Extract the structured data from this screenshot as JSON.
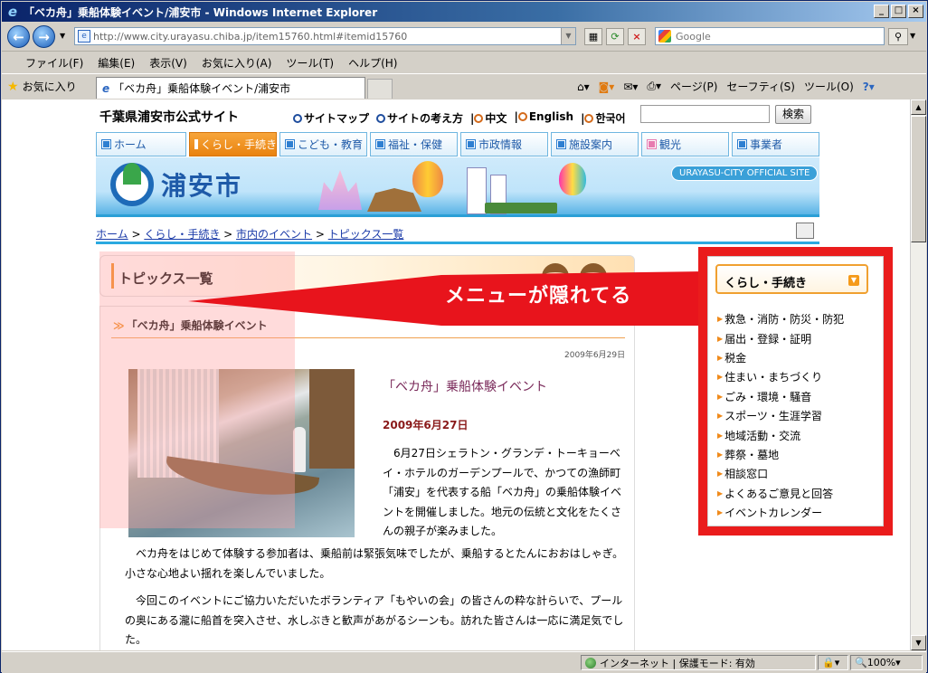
{
  "window": {
    "title": "「ベカ舟」乗船体験イベント/浦安市 - Windows Internet Explorer",
    "address": "http://www.city.urayasu.chiba.jp/item15760.html#itemid15760",
    "search_placeholder": "Google",
    "menus": [
      "ファイル(F)",
      "編集(E)",
      "表示(V)",
      "お気に入り(A)",
      "ツール(T)",
      "ヘルプ(H)"
    ],
    "favorites_label": "お気に入り",
    "tab_label": "「ベカ舟」乗船体験イベント/浦安市",
    "commands": [
      "ページ(P)",
      "セーフティ(S)",
      "ツール(O)"
    ],
    "status_zone": "インターネット | 保護モード: 有効",
    "zoom": "100%"
  },
  "site": {
    "title": "千葉県浦安市公式サイト",
    "toplinks": [
      "サイトマップ",
      "サイトの考え方"
    ],
    "langs": [
      "中文",
      "English",
      "한국어"
    ],
    "search_button": "検索",
    "logo_text": "浦安市",
    "official_badge": "URAYASU-CITY OFFICIAL SITE",
    "nav": [
      "ホーム",
      "くらし・手続き",
      "こども・教育",
      "福祉・保健",
      "市政情報",
      "施設案内",
      "観光",
      "事業者"
    ],
    "breadcrumb": [
      "ホーム",
      "くらし・手続き",
      "市内のイベント",
      "トピックス一覧"
    ]
  },
  "content": {
    "section_title": "トピックス一覧",
    "article_heading": "「ベカ舟」乗船体験イベント",
    "pub_date": "2009年6月29日",
    "article_title": "「ベカ舟」乗船体験イベント",
    "article_date": "2009年6月27日",
    "paragraphs": [
      "6月27日シェラトン・グランデ・トーキョーベイ・ホテルのガーデンプールで、かつての漁師町「浦安」を代表する船「ベカ舟」の乗船体験イベントを開催しました。地元の伝統と文化をたくさんの親子が楽みました。",
      "ベカ舟をはじめて体験する参加者は、乗船前は緊張気味でしたが、乗船するとたんにおおはしゃぎ。小さな心地よい揺れを楽しんでいました。",
      "今回このイベントにご協力いただいたボランティア「もやいの会」の皆さんの粋な計らいで、プールの奥にある瀧に船首を突入させ、水しぶきと歓声があがるシーンも。訪れた皆さんは一応に満足気でした。"
    ]
  },
  "side_menu": {
    "header": "くらし・手続き",
    "items": [
      "救急・消防・防災・防犯",
      "届出・登録・証明",
      "税金",
      "住まい・まちづくり",
      "ごみ・環境・騒音",
      "スポーツ・生涯学習",
      "地域活動・交流",
      "葬祭・墓地",
      "相談窓口",
      "よくあるご意見と回答",
      "イベントカレンダー"
    ]
  },
  "annotation": {
    "text": "メニューが隠れてる",
    "color": "#e8141c"
  }
}
